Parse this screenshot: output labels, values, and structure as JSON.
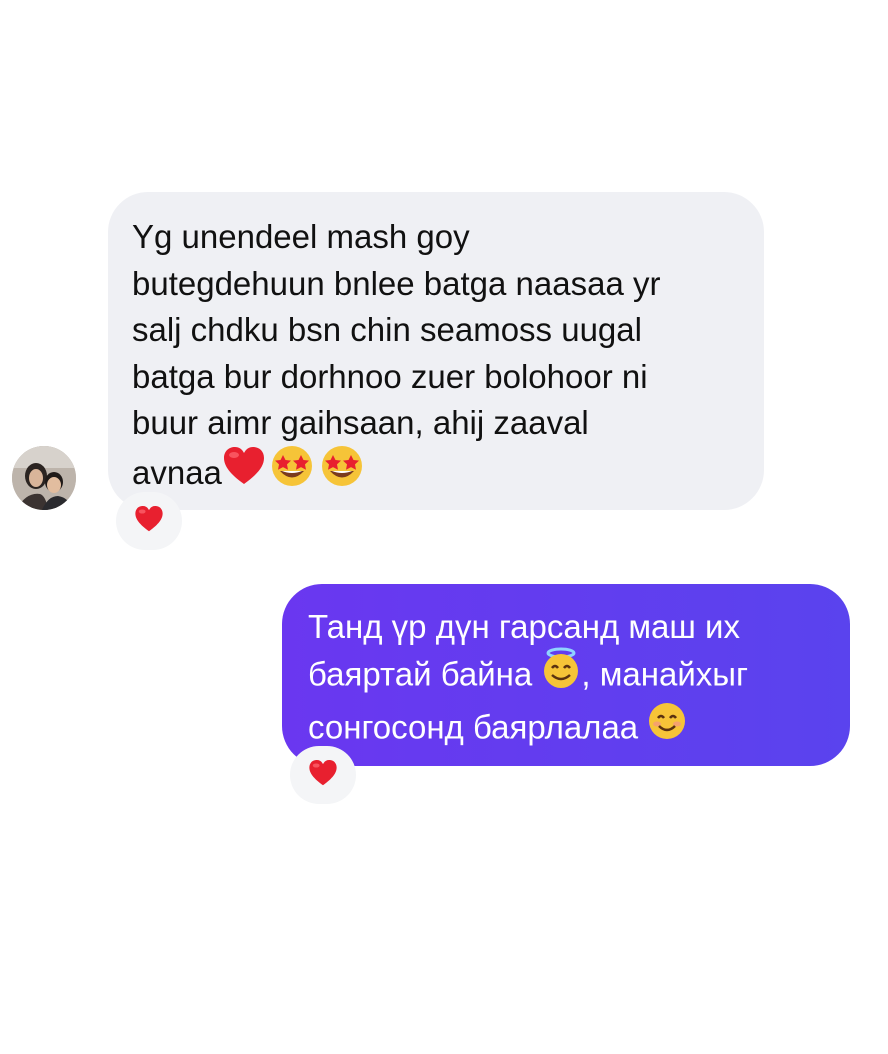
{
  "conversation": {
    "incoming_message": {
      "lines": [
        "Yg unendeel mash goy",
        "butegdehuun bnlee batga naasaa yr",
        "salj chdku bsn chin seamoss uugal",
        "batga bur dorhnoo zuer bolohoor ni",
        "buur aimr gaihsaan, ahij zaaval",
        "avnaa"
      ],
      "trailing_emojis": [
        "heart-icon",
        "star-struck-emoji-icon",
        "star-struck-emoji-icon"
      ],
      "reaction": "heart-icon"
    },
    "outgoing_message": {
      "line1": "Танд үр дүн гарсанд маш их",
      "line2_before_emoji": "баяртай байна",
      "line2_emoji": "smiling-face-with-halo-icon",
      "line2_after_emoji": ", манайхыг",
      "line3": "сонгосонд баярлалаа",
      "line3_emoji": "smiling-face-icon",
      "reaction": "heart-icon"
    }
  },
  "colors": {
    "incoming_bubble": "#eff0f4",
    "outgoing_bubble_start": "#6a37f0",
    "outgoing_bubble_end": "#5a43ee",
    "heart": "#e8202f",
    "emoji_yellow": "#f6c438"
  }
}
